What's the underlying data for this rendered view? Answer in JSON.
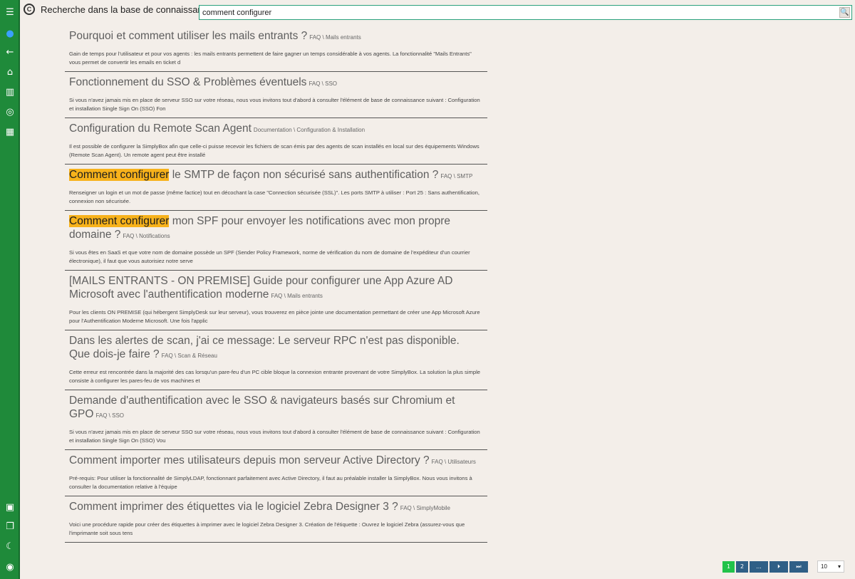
{
  "header": {
    "logo": "C",
    "title": "Recherche dans la base de connaissance",
    "search_value": "comment configurer",
    "search_icon": "🔍"
  },
  "sidebar": {
    "icons": [
      "menu-icon",
      "dot-icon",
      "back-icon",
      "home-icon",
      "book-icon",
      "target-icon",
      "grid-icon",
      "knowledge-icon",
      "chat-icon",
      "moon-icon",
      "user-icon"
    ]
  },
  "results": [
    {
      "pre": "",
      "hl": "",
      "title": "Pourquoi et comment utiliser les mails entrants ?",
      "category": "FAQ \\ Mails entrants",
      "snippet": "Gain de temps pour l'utilisateur et pour vos agents : les mails entrants permettent de faire gagner un temps considérable à vos agents. La fonctionnalité \"Mails Entrants\" vous permet de convertir les emails en ticket d"
    },
    {
      "pre": "",
      "hl": "",
      "title": "Fonctionnement du SSO & Problèmes éventuels",
      "category": "FAQ \\ SSO",
      "snippet": "Si vous n'avez jamais mis en place de serveur SSO sur votre réseau, nous vous invitons tout d'abord à consulter l'élément de base de connaissance suivant : Configuration et installation Single Sign On (SSO) Fon"
    },
    {
      "pre": "",
      "hl": "",
      "title": "Configuration du Remote Scan Agent",
      "category": "Documentation \\ Configuration & Installation",
      "snippet": "Il est possible de configurer la SimplyBox afin que celle-ci puisse recevoir les fichiers de scan émis par des agents de scan installés en local sur des équipements Windows (Remote Scan Agent). Un remote agent peut être installé"
    },
    {
      "pre": "",
      "hl": "Comment configurer",
      "title": " le SMTP de façon non sécurisé sans authentification ?",
      "category": "FAQ \\ SMTP",
      "snippet": "Renseigner un login et un mot de passe (même factice) tout en décochant la case \"Connection sécurisée (SSL)\". Les ports SMTP à utiliser : Port 25 : Sans authentification, connexion non sécurisée."
    },
    {
      "pre": "",
      "hl": "Comment configurer",
      "title": " mon SPF pour envoyer les notifications avec mon propre domaine ?",
      "category": "FAQ \\ Notifications",
      "snippet": "Si vous êtes en SaaS et que votre nom de domaine possède un SPF (Sender Policy Framework, norme de vérification du nom de domaine de l'expéditeur d'un courrier électronique), il faut que vous autorisiez notre serve"
    },
    {
      "pre": "[MAILS ENTRANTS - ON PREMISE] Guide pour configurer une App Azure AD Microsoft avec l'authentification moderne",
      "hl": "",
      "title": "",
      "category": "FAQ \\ Mails entrants",
      "snippet": "Pour les clients ON PREMISE (qui hébergent SimplyDesk sur leur serveur), vous trouverez en pièce jointe une documentation permettant de créer une App Microsoft Azure pour l'Authentification Moderne Microsoft. Une fois l'applic"
    },
    {
      "pre": "Dans les alertes de scan, j'ai ce message: Le serveur RPC n'est pas disponible. Que dois-je faire ?",
      "hl": "",
      "title": "",
      "category": "FAQ \\ Scan & Réseau",
      "snippet": "Cette erreur est rencontrée dans la majorité des cas lorsqu'un pare-feu d'un PC cible bloque la connexion entrante provenant de votre SimplyBox. La solution la plus simple consiste à configurer les pares-feu de vos machines et"
    },
    {
      "pre": "Demande d'authentification avec le SSO & navigateurs basés sur Chromium et GPO",
      "hl": "",
      "title": "",
      "category": "FAQ \\ SSO",
      "snippet": "Si vous n'avez jamais mis en place de serveur SSO sur votre réseau, nous vous invitons tout d'abord à consulter l'élément de base de connaissance suivant : Configuration et installation Single Sign On (SSO) Vou"
    },
    {
      "pre": "Comment importer mes utilisateurs depuis mon serveur Active Directory ?",
      "hl": "",
      "title": "",
      "category": "FAQ \\ Utilisateurs",
      "snippet": "Pré-requis: Pour utiliser la fonctionnalité de SimplyLDAP, fonctionnant parfaitement avec Active Directory, il faut au préalable installer la SimplyBox. Nous vous invitons à consulter la documentation relative à l'équipe"
    },
    {
      "pre": "Comment imprimer des étiquettes via le logiciel Zebra Designer 3 ?",
      "hl": "",
      "title": "",
      "category": "FAQ \\ SimplyMobile",
      "snippet": "Voici une procédure rapide pour créer des étiquettes à imprimer avec le logiciel Zebra Designer 3.   Création de l'étiquette : Ouvrez le logiciel Zebra (assurez-vous que l'imprimante soit sous tens"
    }
  ],
  "pagination": {
    "pages": [
      "1",
      "2"
    ],
    "ellipsis": "...",
    "next": "⏭",
    "last": "⏭",
    "per_page": "10",
    "chevron": "▾"
  }
}
